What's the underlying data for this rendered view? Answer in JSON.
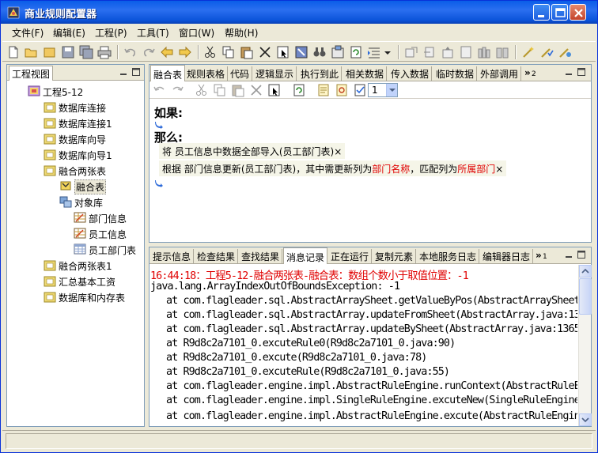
{
  "window": {
    "title": "商业规则配置器",
    "colors": {
      "titlebar": "#0A5DE8",
      "highlight": "#E00000",
      "panel_border": "#7F9DB9"
    }
  },
  "menubar": {
    "items": [
      "文件(F)",
      "编辑(E)",
      "工程(P)",
      "工具(T)",
      "窗口(W)",
      "帮助(H)"
    ]
  },
  "left_panel": {
    "tab_label": "工程视图",
    "tree": [
      {
        "label": "工程5-12",
        "icon": "project-icon"
      },
      {
        "label": "数据库连接",
        "icon": "folder-icon"
      },
      {
        "label": "数据库连接1",
        "icon": "folder-icon"
      },
      {
        "label": "数据库向导",
        "icon": "folder-icon"
      },
      {
        "label": "数据库向导1",
        "icon": "folder-icon"
      },
      {
        "label": "融合两张表",
        "icon": "folder-icon"
      },
      {
        "label": "融合表",
        "icon": "rule-icon"
      },
      {
        "label": "对象库",
        "icon": "object-library-icon"
      },
      {
        "label": "部门信息",
        "icon": "sheet-icon"
      },
      {
        "label": "员工信息",
        "icon": "sheet-icon"
      },
      {
        "label": "员工部门表",
        "icon": "table-icon"
      },
      {
        "label": "融合两张表1",
        "icon": "folder-icon"
      },
      {
        "label": "汇总基本工资",
        "icon": "folder-icon"
      },
      {
        "label": "数据库和内存表",
        "icon": "folder-icon"
      }
    ]
  },
  "editor": {
    "tabs": [
      "融合表",
      "规则表格",
      "代码",
      "逻辑显示",
      "执行到此",
      "相关数据",
      "传入数据",
      "临时数据",
      "外部调用"
    ],
    "overflow_label": "»",
    "overflow_count": "2",
    "row_select_value": "1",
    "if_label": "如果:",
    "then_label": "那么:",
    "line1": {
      "prefix": "将 ",
      "link": "员工信息",
      "suffix": "中数据全部导入(员工部门表)",
      "close": "×"
    },
    "line2": {
      "prefix": "根据 ",
      "link": "部门信息",
      "mid1": "更新(员工部门表)，其中需更新列为",
      "red1": "部门名称",
      "mid2": "，匹配列为",
      "red2": "所属部门",
      "close": "×"
    }
  },
  "log": {
    "tabs": [
      "提示信息",
      "检查结果",
      "查找结果",
      "消息记录",
      "正在运行",
      "复制元素",
      "本地服务日志",
      "编辑器日志"
    ],
    "overflow_label": "»",
    "overflow_count": "1",
    "lines": [
      "16:44:18：工程5-12-融合两张表-融合表：数组个数小于取值位置：-1",
      "java.lang.ArrayIndexOutOfBoundsException: -1",
      "at com.flagleader.sql.AbstractArraySheet.getValueByPos(AbstractArraySheet.java:",
      "at com.flagleader.sql.AbstractArray.updateFromSheet(AbstractArray.java:1341)",
      "at com.flagleader.sql.AbstractArray.updateBySheet(AbstractArray.java:1365)",
      "at R9d8c2a7101_0.excuteRule0(R9d8c2a7101_0.java:90)",
      "at R9d8c2a7101_0.excute(R9d8c2a7101_0.java:78)",
      "at R9d8c2a7101_0.excuteRule(R9d8c2a7101_0.java:55)",
      "at com.flagleader.engine.impl.AbstractRuleEngine.runContext(AbstractRuleEngine",
      "at com.flagleader.engine.impl.SingleRuleEngine.excuteNew(SingleRuleEngine.java",
      "at com.flagleader.engine.impl.AbstractRuleEngine.excute(AbstractRuleEngine.java"
    ]
  }
}
